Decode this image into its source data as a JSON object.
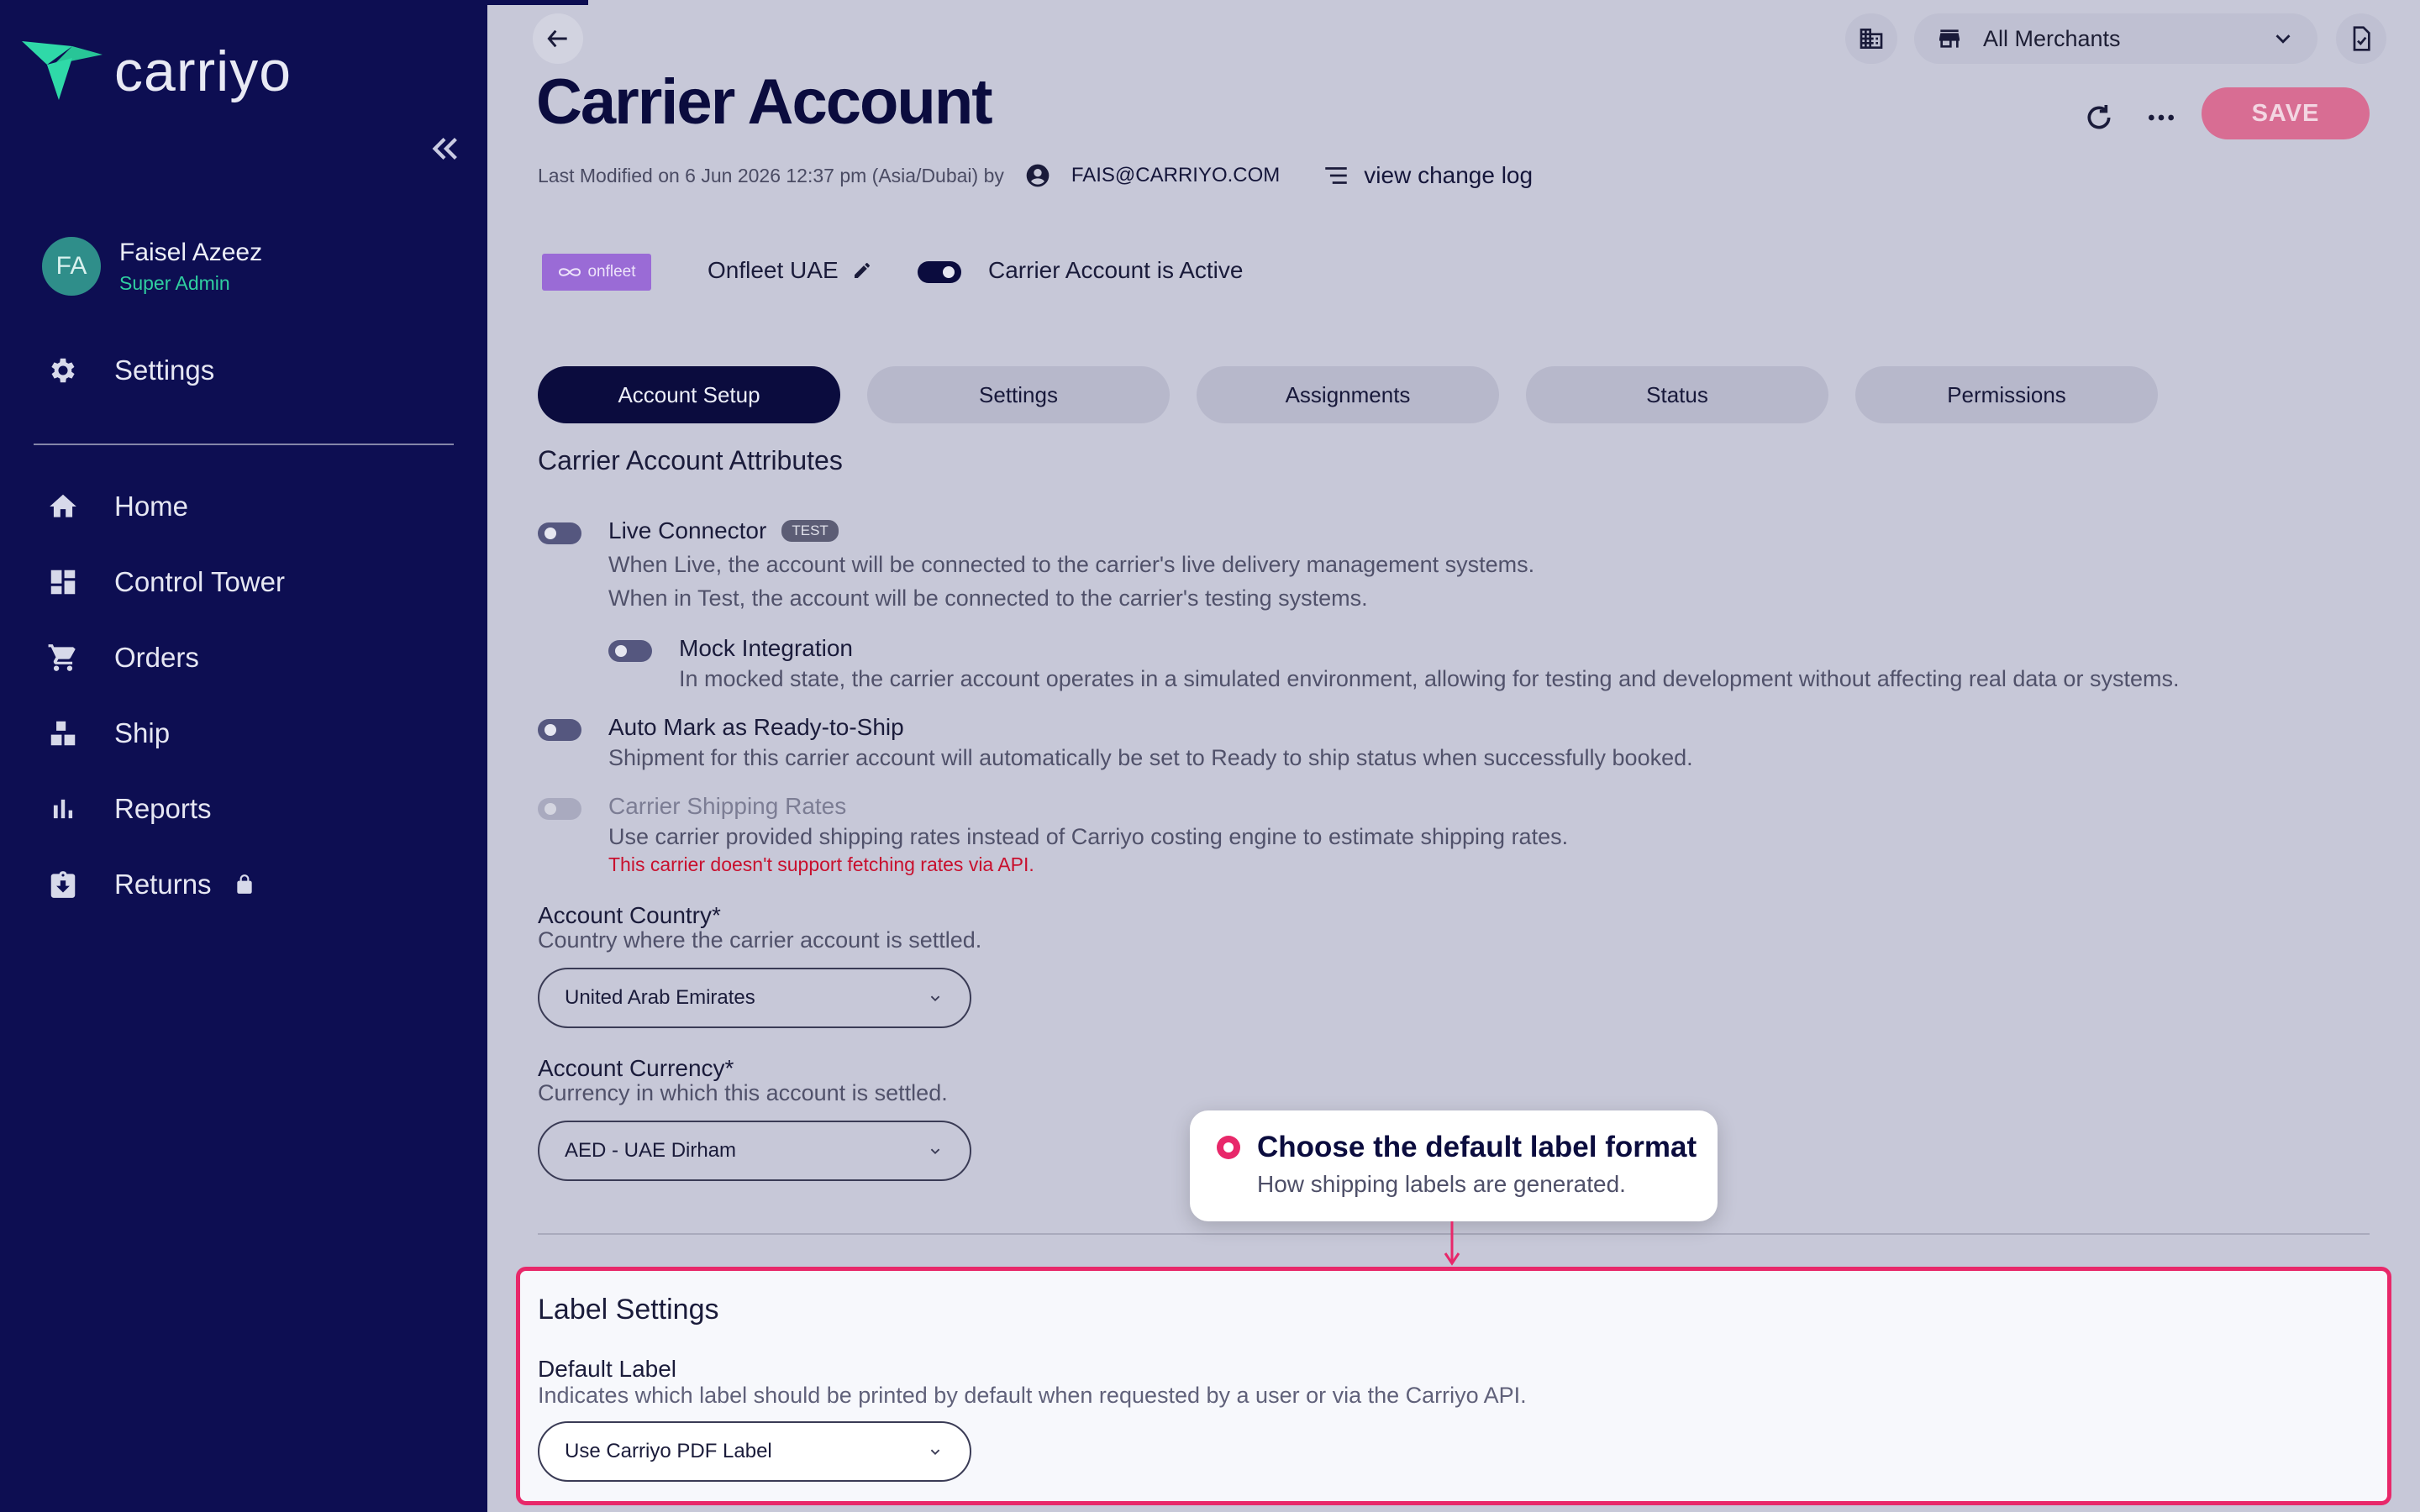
{
  "sidebar": {
    "brand": "carriyo",
    "user": {
      "initials": "FA",
      "name": "Faisel Azeez",
      "role": "Super Admin"
    },
    "settings_label": "Settings",
    "nav": [
      "Home",
      "Control Tower",
      "Orders",
      "Ship",
      "Reports",
      "Returns"
    ]
  },
  "topbar": {
    "merchant_select": "All Merchants"
  },
  "header": {
    "title": "Carrier Account",
    "modified_text": "Last Modified on 6 Jun 2026 12:37 pm (Asia/Dubai) by",
    "modified_by": "FAIS@CARRIYO.COM",
    "change_log": "view change log",
    "save_label": "SAVE"
  },
  "carrier": {
    "logo_text": "onfleet",
    "name": "Onfleet UAE",
    "active_label": "Carrier Account is Active",
    "active": true
  },
  "tabs": [
    "Account Setup",
    "Settings",
    "Assignments",
    "Status",
    "Permissions"
  ],
  "active_tab": "Account Setup",
  "section": {
    "title": "Carrier Account Attributes",
    "attributes": [
      {
        "label": "Live Connector",
        "badge": "TEST",
        "desc1": "When Live, the account will be connected to the carrier's live delivery management systems.",
        "desc2": "When in Test, the account will be connected to the carrier's testing systems.",
        "on": false
      },
      {
        "label": "Mock Integration",
        "desc1": "In mocked state, the carrier account operates in a simulated environment, allowing for testing and development without affecting real data or systems.",
        "on": false
      },
      {
        "label": "Auto Mark as Ready-to-Ship",
        "desc1": "Shipment for this carrier account will automatically be set to Ready to ship status when successfully booked.",
        "on": false
      },
      {
        "label": "Carrier Shipping Rates",
        "desc1": "Use carrier provided shipping rates instead of Carriyo costing engine to estimate shipping rates.",
        "error": "This carrier doesn't support fetching rates via API.",
        "on": false,
        "disabled": true
      }
    ],
    "account_country": {
      "label": "Account Country*",
      "desc": "Country where the carrier account is settled.",
      "value": "United Arab Emirates"
    },
    "account_currency": {
      "label": "Account Currency*",
      "desc": "Currency in which this account is settled.",
      "value": "AED - UAE Dirham"
    }
  },
  "label_settings": {
    "title": "Label Settings",
    "field_label": "Default Label",
    "field_desc": "Indicates which label should be printed by default when requested by a user or via the Carriyo API.",
    "value": "Use Carriyo PDF Label"
  },
  "tooltip": {
    "title": "Choose the default label format",
    "subtitle": "How shipping labels are generated."
  },
  "colors": {
    "sidebar": "#0d0e52",
    "accent": "#e8286a",
    "save": "#d86d93",
    "background": "#c7c8d8"
  }
}
